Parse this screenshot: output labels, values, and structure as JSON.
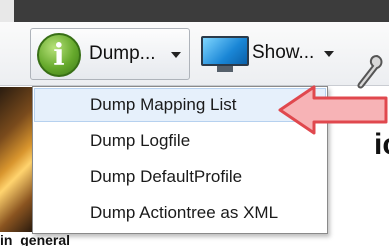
{
  "toolbar": {
    "dump_label": "Dump...",
    "show_label": "Show..."
  },
  "dump_menu": {
    "items": [
      {
        "label": "Dump Mapping List"
      },
      {
        "label": "Dump Logfile"
      },
      {
        "label": "Dump DefaultProfile"
      },
      {
        "label": "Dump Actiontree as XML"
      }
    ]
  },
  "background": {
    "partial_char": "ic",
    "bottom_text": "in_general"
  },
  "colors": {
    "info_icon": "#66a92c",
    "arrow_fill": "#f7b3b6",
    "arrow_stroke": "#e0484e"
  }
}
